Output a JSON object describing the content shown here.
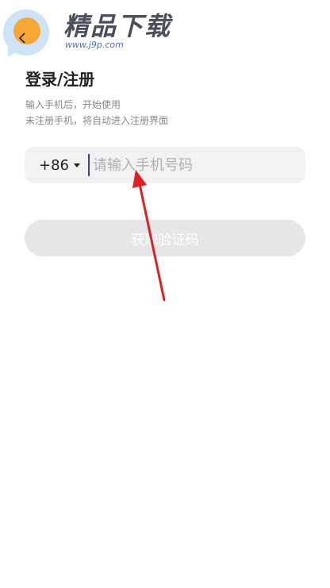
{
  "watermark": {
    "title": "精品下载",
    "url": "www.j9p.com"
  },
  "header": {
    "back_icon": "chevron-left-icon"
  },
  "page": {
    "title": "登录/注册",
    "subtitle_line1": "输入手机后，开始使用",
    "subtitle_line2": "未注册手机，将自动进入注册界面"
  },
  "phone": {
    "country_code": "+86",
    "placeholder": "请输入手机号码",
    "value": ""
  },
  "actions": {
    "get_code_label": "获取验证码"
  },
  "colors": {
    "annotation_arrow": "#e02020",
    "input_bg": "#f2f2f2",
    "button_disabled_bg": "#e6e6e6",
    "logo_orange": "#f7a834",
    "logo_blue": "#cfe3f7"
  }
}
